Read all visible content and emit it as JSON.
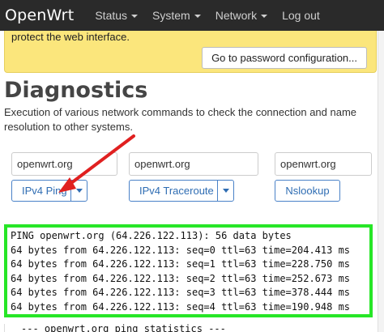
{
  "navbar": {
    "brand": "OpenWrt",
    "items": [
      {
        "label": "Status",
        "has_caret": true
      },
      {
        "label": "System",
        "has_caret": true
      },
      {
        "label": "Network",
        "has_caret": true
      },
      {
        "label": "Log out",
        "has_caret": false
      }
    ]
  },
  "alert": {
    "text": "protect the web interface.",
    "button_label": "Go to password configuration..."
  },
  "page": {
    "title": "Diagnostics",
    "description": "Execution of various network commands to check the connection and name resolution to other systems."
  },
  "tools": {
    "ping": {
      "input_value": "openwrt.org",
      "button_label": "IPv4 Ping"
    },
    "traceroute": {
      "input_value": "openwrt.org",
      "button_label": "IPv4 Traceroute"
    },
    "nslookup": {
      "input_value": "openwrt.org",
      "button_label": "Nslookup"
    }
  },
  "output": {
    "lines": [
      "PING openwrt.org (64.226.122.113): 56 data bytes",
      "64 bytes from 64.226.122.113: seq=0 ttl=63 time=204.413 ms",
      "64 bytes from 64.226.122.113: seq=1 ttl=63 time=228.750 ms",
      "64 bytes from 64.226.122.113: seq=2 ttl=63 time=252.673 ms",
      "64 bytes from 64.226.122.113: seq=3 ttl=63 time=378.444 ms",
      "64 bytes from 64.226.122.113: seq=4 ttl=63 time=190.948 ms"
    ],
    "trailing_line": "--- openwrt.org ping statistics ---"
  },
  "colors": {
    "navbar_bg": "#2a2a2a",
    "alert_bg": "#fbe67c",
    "button_border": "#4a82c8",
    "highlight_box": "#27e627",
    "annotation_arrow": "#e02020"
  },
  "icons": {
    "dropdown": "chevron-down-icon",
    "annotation": "red-arrow-icon"
  }
}
